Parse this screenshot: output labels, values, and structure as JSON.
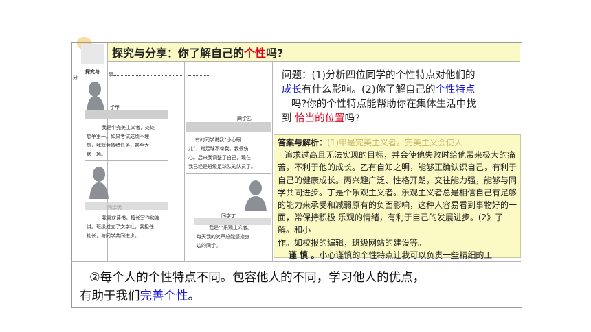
{
  "header": {
    "prefix": "探究与分享：你了解自己的",
    "highlight": "个性",
    "suffix": "吗?"
  },
  "left_panel": {
    "side_label": "分",
    "title_label": "探究与",
    "top_label": "享",
    "student_a": {
      "name": "学甲",
      "text_line1": "我是个完美主义者，处处",
      "text_line2": "想争第一。如果考试成绩不理",
      "text_line3": "想，我就会情绪低落，甚至大",
      "text_line4": "病一场。"
    },
    "student_b": {
      "name": "同学乙",
      "text_line1": "有的同学说我“小心眼",
      "text_line2": "儿”，蹭足球不带我，我很伤",
      "text_line3": "心。后来我调整了自己，现在",
      "text_line4": "我已经是班级足球队的队员了。"
    },
    "student_c": {
      "name": "同学丙",
      "text_line1": "我喜欢读书，擅长写作和演",
      "text_line2": "讲。班级成立了文学社，我担任",
      "text_line3": "社长，与同学共同进步。"
    },
    "student_d": {
      "name": "同学丁",
      "text_line1": "我是个乐观主义者。",
      "text_line2": "每天我的笑声总能感染身",
      "text_line3": "边的同学。"
    }
  },
  "question": {
    "p1": "问题：(1)分析四位同学的个性特点对他们的",
    "p2_blue": "成长",
    "p2_rest": "有什么影响。(2)你了解自己的",
    "p2_blue2": "个性特点",
    "p3": "吗?你的个性特点能帮助你在集体生活中找",
    "p4_pre": "到 ",
    "p4_red": "恰当的位置",
    "p4_post": "吗?"
  },
  "answer": {
    "label": "答案与解析：",
    "dim": "(1)甲是完美主义者。完美主义会使人",
    "body": "追求过高且无法实现的目标，并会使他失败时给他带来极大的痛苦，不利于他的成长。乙有自知之明，能够正确认识自己，有利于自己的健康成长。丙兴趣广泛、性格开朗，交往能力强，能够与同学共同进步。丁是个乐观主义者。乐观主义者总是相信自己有足够的能力来承受和减弱原有的负面影响，这种人容易看到事物好的一面，常保持积极 乐观的情绪，有利于自己的发展进步。(2》了解。和小",
    "tail": "作。如校报的编辑，班级网站的建设等。",
    "last_bold": "谨 慎 。",
    "last_rest": "小心谨慎的个性特点让我可以负责一些精细的工"
  },
  "conclusion": {
    "line1": "②每个人的个性特点不同。包容他人的不同，学习他人的优点，",
    "line2_pre": "有助于我们",
    "line2_blue": "完善个性",
    "line2_post": "。"
  }
}
